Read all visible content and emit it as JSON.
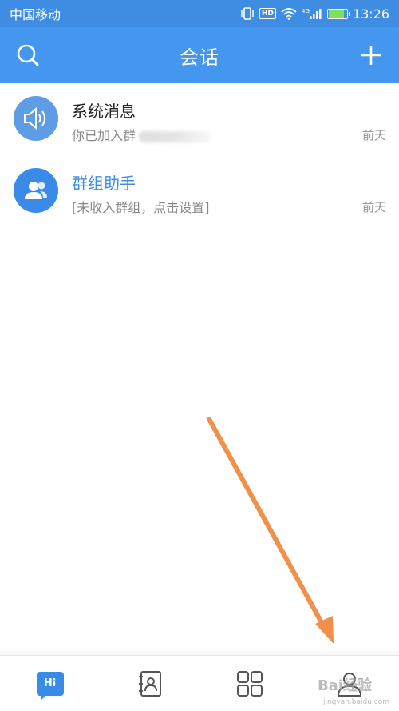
{
  "status_bar": {
    "carrier": "中国移动",
    "network": "4G",
    "hd_label": "HD",
    "time": "13:26",
    "battery_level": 0.85
  },
  "nav": {
    "title": "会话",
    "left_icon": "search-icon",
    "right_icon": "plus-icon"
  },
  "conversations": [
    {
      "title": "系统消息",
      "subtitle": "你已加入群",
      "time": "前天",
      "avatar_icon": "speaker-icon",
      "avatar_color": "#5e9de6"
    },
    {
      "title": "群组助手",
      "subtitle": "[未收入群组，点击设置]",
      "time": "前天",
      "avatar_icon": "group-icon",
      "avatar_color": "#3a8ae8"
    }
  ],
  "tabs": [
    {
      "icon": "hi-chat-icon",
      "label": "Hi",
      "active": true
    },
    {
      "icon": "contacts-icon",
      "active": false
    },
    {
      "icon": "apps-grid-icon",
      "active": false
    },
    {
      "icon": "profile-icon",
      "active": false
    }
  ],
  "watermark": {
    "text": "Bai经验",
    "sub": "jingyan.baidu.com"
  },
  "colors": {
    "accent": "#4596ee",
    "status_bar": "#3f8de2",
    "arrow": "#f0904a",
    "tab_inactive": "#555555"
  }
}
